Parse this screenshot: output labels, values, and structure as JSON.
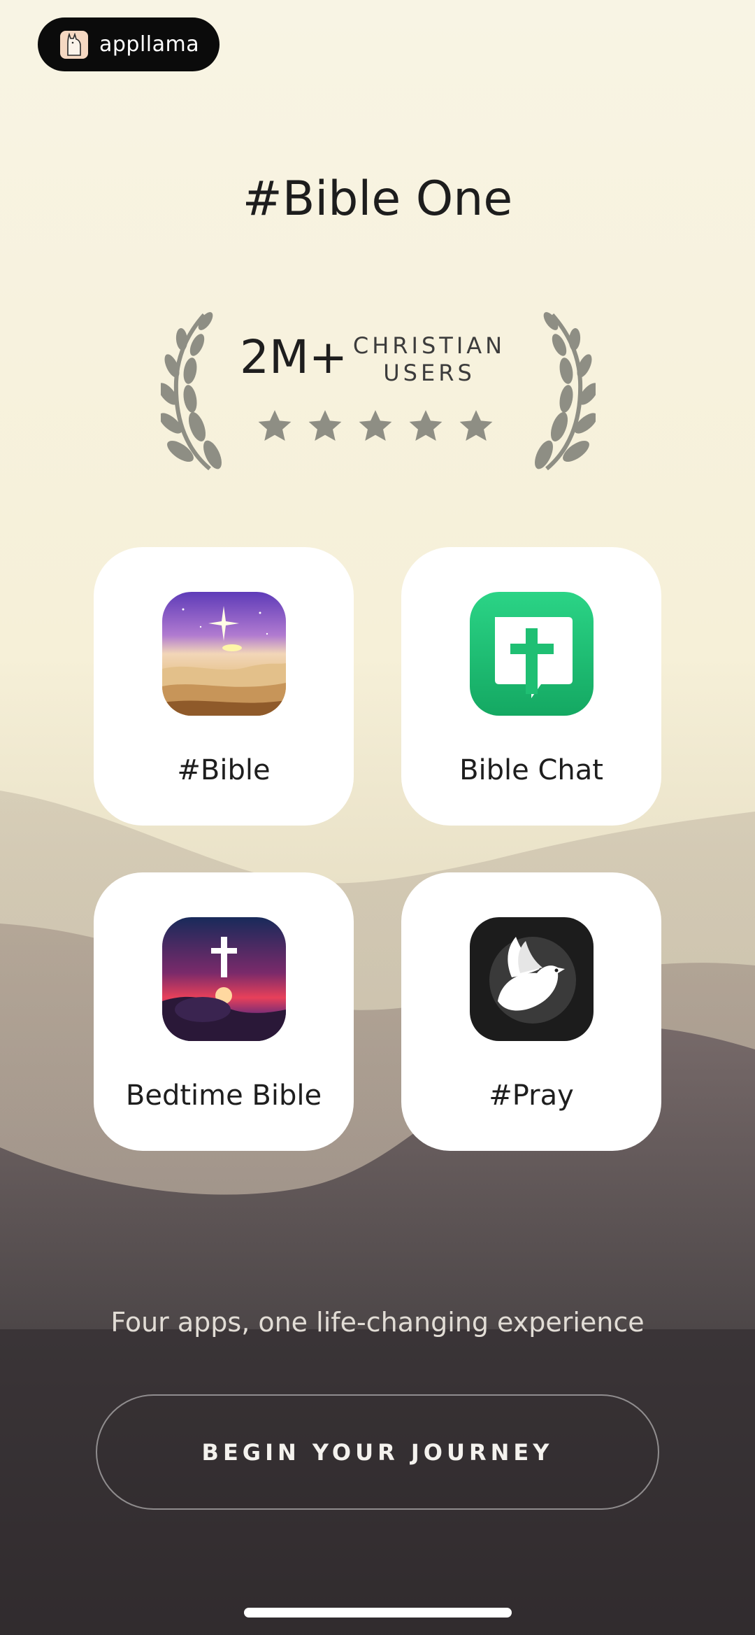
{
  "brand": {
    "name": "appllama"
  },
  "title": "#Bible One",
  "stats": {
    "count": "2M+",
    "label_line1": "CHRISTIAN",
    "label_line2": "USERS",
    "rating_stars": 5
  },
  "apps": [
    {
      "name": "#Bible",
      "icon": "sunset-star-icon"
    },
    {
      "name": "Bible Chat",
      "icon": "chat-cross-icon"
    },
    {
      "name": "Bedtime Bible",
      "icon": "night-cross-icon"
    },
    {
      "name": "#Pray",
      "icon": "dove-icon"
    }
  ],
  "tagline": "Four apps, one life-changing experience",
  "cta": {
    "label": "BEGIN YOUR JOURNEY"
  },
  "colors": {
    "accent_green": "#1fbf73",
    "laurel_gray": "#8e8e84",
    "card_bg": "#ffffff"
  }
}
